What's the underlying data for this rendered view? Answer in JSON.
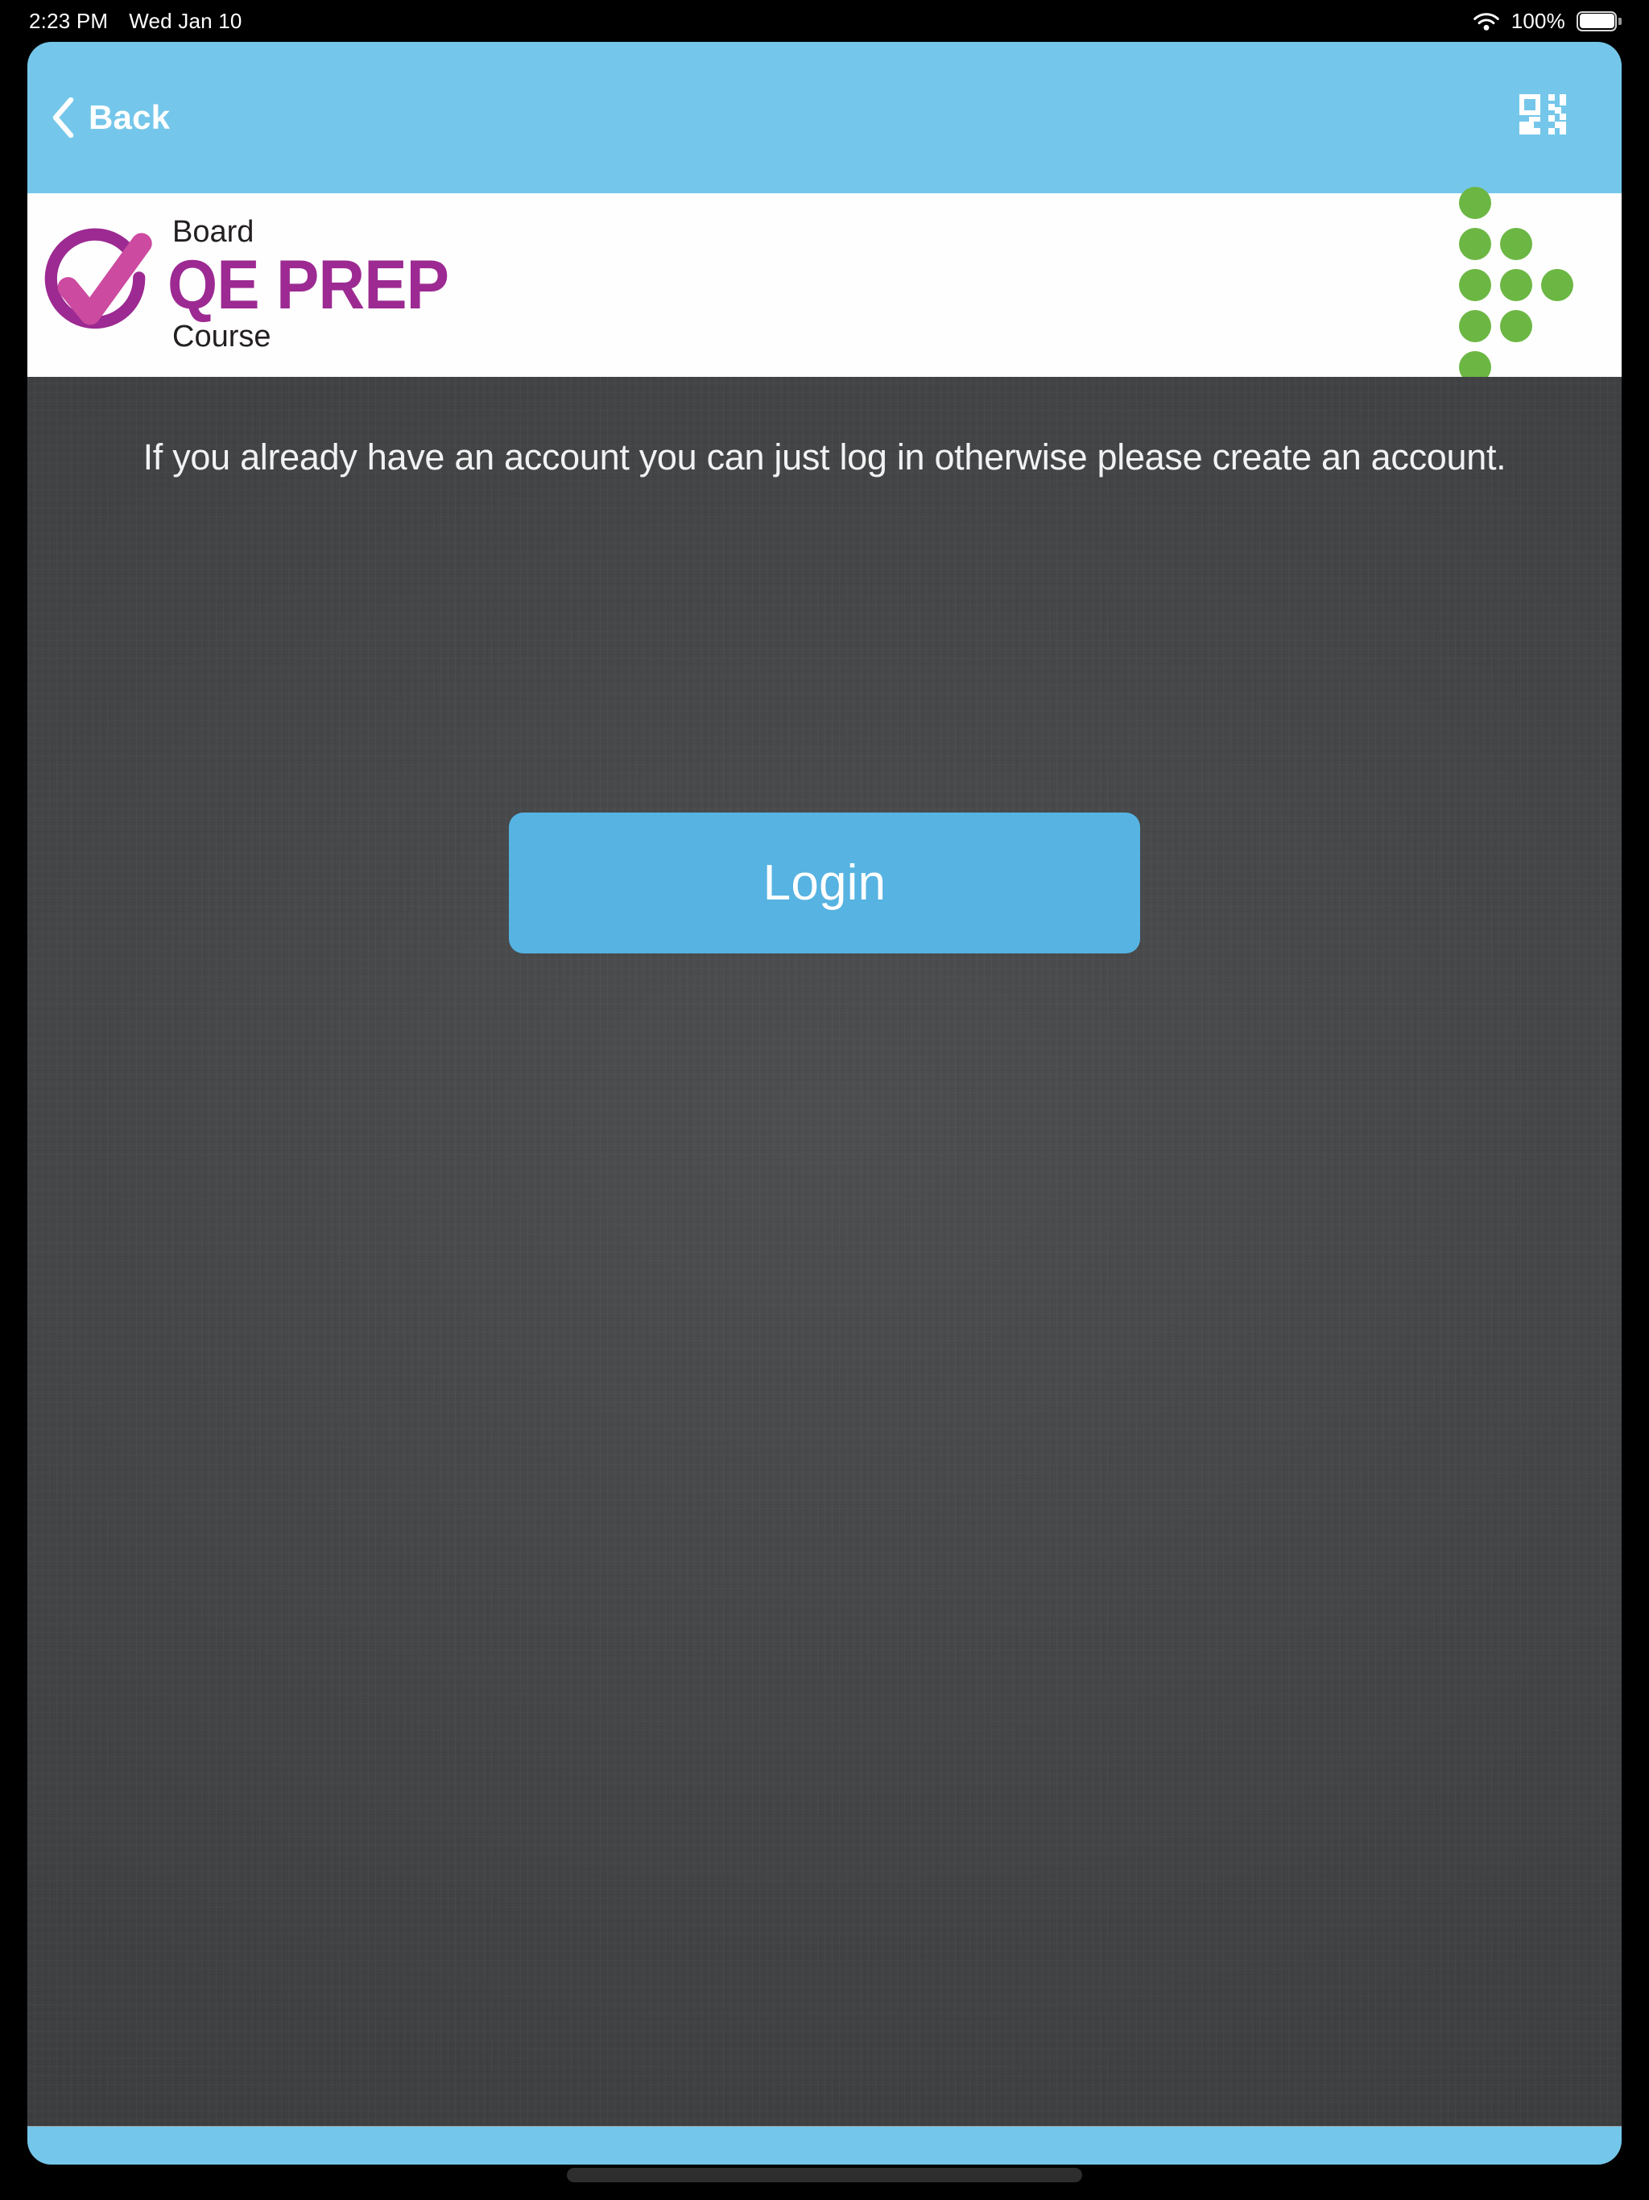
{
  "status_bar": {
    "time": "2:23 PM",
    "date": "Wed Jan 10",
    "battery_percent": "100%",
    "wifi_icon": "wifi-icon",
    "battery_icon": "battery-full-icon"
  },
  "nav_bar": {
    "back_label": "Back",
    "back_icon": "chevron-left-icon",
    "qr_icon": "qr-code-icon",
    "background_color": "#74c7ea"
  },
  "logo_bar": {
    "brand_top": "Board",
    "brand_main": "QE PREP",
    "brand_bottom": "Course",
    "mark_icon": "check-circle-logo-icon",
    "brand_color": "#9c2a92",
    "check_color": "#cc4aa0",
    "dot_pattern_icon": "green-dot-pattern-icon",
    "dot_color": "#6cb744",
    "dot_grid": [
      [
        1,
        0,
        0
      ],
      [
        1,
        1,
        0
      ],
      [
        1,
        1,
        1
      ],
      [
        1,
        1,
        0
      ],
      [
        1,
        0,
        0
      ]
    ]
  },
  "content": {
    "intro_text": "If you already have an account you can just log in otherwise please create an account.",
    "login_label": "Login",
    "login_color": "#56b3e2",
    "background_color": "#454749"
  },
  "bottom_bar": {
    "background_color": "#74c7ea"
  }
}
